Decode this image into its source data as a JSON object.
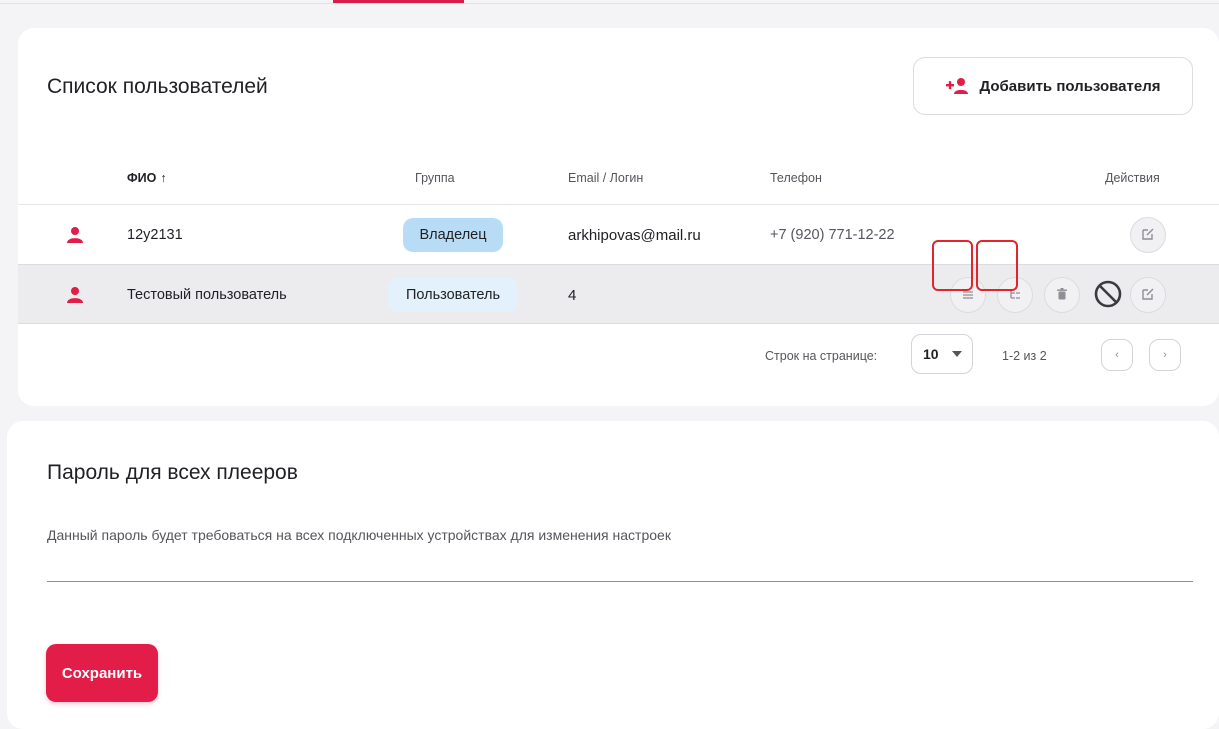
{
  "colors": {
    "accent": "#e11d48",
    "owner_badge": "#b9dcf6",
    "user_badge": "#e2f1fb",
    "highlight": "#e0262b"
  },
  "users_section": {
    "title": "Список пользователей",
    "add_button_label": "Добавить пользователя",
    "add_button_icon": "person-add-icon",
    "columns": {
      "name": "ФИО",
      "name_sort_arrow": "↑",
      "group": "Группа",
      "email": "Email / Логин",
      "phone": "Телефон",
      "actions": "Действия"
    },
    "rows": [
      {
        "avatar_icon": "person-icon",
        "name": "12y2131",
        "group": "Владелец",
        "email": "arkhipovas@mail.ru",
        "phone": "+7 (920) 771-12-22",
        "actions": [
          "edit-icon"
        ]
      },
      {
        "avatar_icon": "person-icon",
        "name": "Тестовый пользователь",
        "group": "Пользователь",
        "email": "4",
        "phone": "",
        "actions": [
          "list-icon",
          "tree-icon",
          "trash-icon",
          "block-icon",
          "edit-icon"
        ]
      }
    ],
    "pagination": {
      "rows_per_page_label": "Строк на странице:",
      "rows_per_page_value": "10",
      "range": "1-2 из 2",
      "prev_symbol": "‹",
      "next_symbol": "›"
    }
  },
  "password_section": {
    "title": "Пароль для всех плееров",
    "description": "Данный пароль будет требоваться на всех подключенных устройствах для изменения настроек",
    "input_value": "",
    "save_label": "Сохранить"
  }
}
